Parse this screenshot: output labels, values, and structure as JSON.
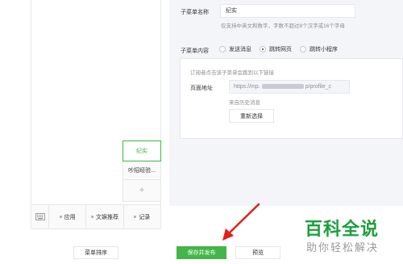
{
  "preview": {
    "menu_items": [
      "应用",
      "文娱推荐",
      "记录"
    ],
    "submenu": {
      "active": "纪实",
      "second": "吵招经验...",
      "add_symbol": "+"
    }
  },
  "editor": {
    "name_label": "子菜单名称",
    "name_value": "纪实",
    "name_hint": "仅支持中英文和数字，字数不超过8个汉字或16个字母",
    "content_label": "子菜单内容",
    "options": [
      "发送消息",
      "跳转网页",
      "跳转小程序"
    ],
    "selected_option": "跳转网页",
    "box_hint": "订阅者点击该子菜单会跳到以下链接",
    "url_label": "页面地址",
    "url_prefix": "https://mp.",
    "url_suffix": "p/profile_c",
    "source_text": "来自历史消息",
    "reselect_label": "重新选择"
  },
  "footer": {
    "sort_label": "菜单排序",
    "save_label": "保存并发布",
    "preview_label": "预览"
  },
  "watermark": {
    "title": "百科全说",
    "subtitle": "助你轻松解决"
  },
  "colors": {
    "accent": "#44b549",
    "arrow": "#e0201b",
    "watermark": "#1a9f3c"
  }
}
